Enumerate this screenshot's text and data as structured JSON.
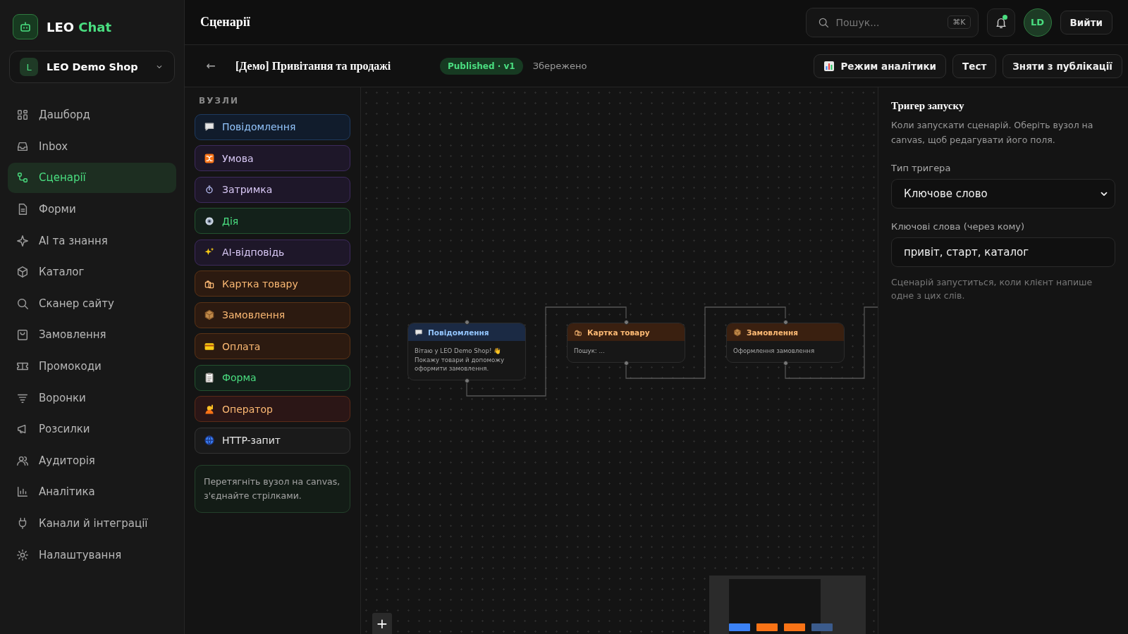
{
  "brand": {
    "name": "LEO",
    "accent": "Chat"
  },
  "workspace": {
    "initial": "L",
    "name": "LEO Demo Shop"
  },
  "sidebar": {
    "items": [
      {
        "label": "Дашборд",
        "selected": false
      },
      {
        "label": "Inbox",
        "selected": false
      },
      {
        "label": "Сценарії",
        "selected": true
      },
      {
        "label": "Форми",
        "selected": false
      },
      {
        "label": "AI та знання",
        "selected": false
      },
      {
        "label": "Каталог",
        "selected": false
      },
      {
        "label": "Сканер сайту",
        "selected": false
      },
      {
        "label": "Замовлення",
        "selected": false
      },
      {
        "label": "Промокоди",
        "selected": false
      },
      {
        "label": "Воронки",
        "selected": false
      },
      {
        "label": "Розсилки",
        "selected": false
      },
      {
        "label": "Аудиторія",
        "selected": false
      },
      {
        "label": "Аналітика",
        "selected": false
      },
      {
        "label": "Канали й інтеграції",
        "selected": false
      },
      {
        "label": "Налаштування",
        "selected": false
      }
    ]
  },
  "topbar": {
    "title": "Сценарії",
    "search": {
      "placeholder": "Пошук...",
      "shortcut": "⌘K"
    },
    "notifications": {
      "unread": true
    },
    "avatar": "LD",
    "logout": "Вийти"
  },
  "editor": {
    "back": "←",
    "title": "[Демо] Привітання та продажі",
    "badge": "Published · v1",
    "save_status": "Збережено",
    "actions": [
      {
        "label": "Режим аналітики",
        "kind": "analytics"
      },
      {
        "label": "Тест",
        "kind": "plain"
      },
      {
        "label": "Зняти з публікації",
        "kind": "plain"
      }
    ]
  },
  "palette": {
    "heading": "ВУЗЛИ",
    "items": [
      {
        "label": "Повідомлення",
        "kind": "message"
      },
      {
        "label": "Умова",
        "kind": "condition"
      },
      {
        "label": "Затримка",
        "kind": "delay"
      },
      {
        "label": "Дія",
        "kind": "action"
      },
      {
        "label": "AI-відповідь",
        "kind": "ai"
      },
      {
        "label": "Картка товару",
        "kind": "product"
      },
      {
        "label": "Замовлення",
        "kind": "order"
      },
      {
        "label": "Оплата",
        "kind": "payment"
      },
      {
        "label": "Форма",
        "kind": "form"
      },
      {
        "label": "Оператор",
        "kind": "operator"
      },
      {
        "label": "HTTP-запит",
        "kind": "http"
      }
    ],
    "hint": "Перетягніть вузол на canvas, з'єднайте стрілками."
  },
  "canvas": {
    "nodes": [
      {
        "kind": "message",
        "title": "Повідомлення",
        "body": "Вітаю у LEO Demo Shop! 👋 Покажу товари й допоможу оформити замовлення."
      },
      {
        "kind": "product",
        "title": "Картка товару",
        "body": "Пошук: ..."
      },
      {
        "kind": "order",
        "title": "Замовлення",
        "body": "Оформлення замовлення"
      }
    ],
    "zoom_in": "+"
  },
  "inspector": {
    "title": "Тригер запуску",
    "description": "Коли запускати сценарій. Оберіть вузол на canvas, щоб редагувати його поля.",
    "trigger_label": "Тип тригера",
    "trigger_value": "Ключове слово",
    "keywords_label": "Ключові слова (через кому)",
    "keywords_value": "привіт, старт, каталог",
    "hint": "Сценарій запуститься, коли клієнт напише одне з цих слів."
  }
}
